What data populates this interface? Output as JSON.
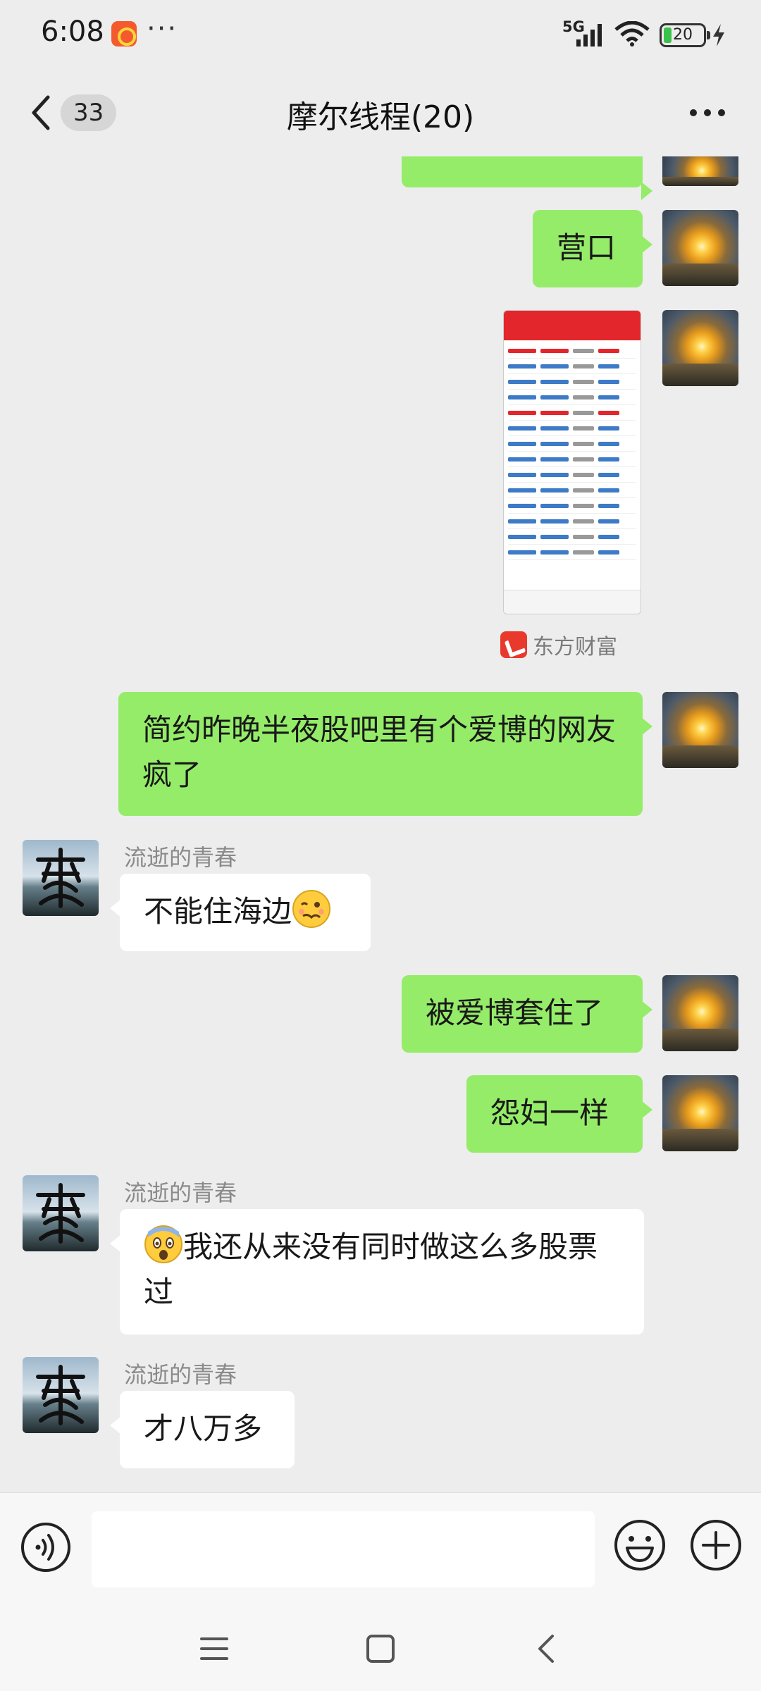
{
  "status_bar": {
    "time": "6:08",
    "more": "···",
    "network": "5G",
    "battery_level": "20",
    "icons": [
      "app-notification-icon",
      "signal-icon",
      "wifi-icon",
      "battery-icon",
      "charging-icon"
    ]
  },
  "header": {
    "unread_count": "33",
    "title": "摩尔线程(20)",
    "icons": [
      "back-icon",
      "more-icon"
    ]
  },
  "messages": [
    {
      "side": "me",
      "type": "text",
      "text": "营口"
    },
    {
      "side": "me",
      "type": "image",
      "source_app": "东方财富"
    },
    {
      "side": "me",
      "type": "text",
      "text": "简约昨晚半夜股吧里有个爱博的网友疯了"
    },
    {
      "side": "other",
      "sender": "流逝的青春",
      "type": "text",
      "text": "不能住海边",
      "emoji": "woozy-face-emoji"
    },
    {
      "side": "me",
      "type": "text",
      "text": "被爱博套住了"
    },
    {
      "side": "me",
      "type": "text",
      "text": "怨妇一样"
    },
    {
      "side": "other",
      "sender": "流逝的青春",
      "type": "text",
      "emoji": "fearful-face-emoji",
      "text": "我还从来没有同时做这么多股票过"
    },
    {
      "side": "other",
      "sender": "流逝的青春",
      "type": "text",
      "text": "才八万多"
    }
  ],
  "input_bar": {
    "placeholder": "",
    "icons": [
      "voice-icon",
      "emoji-icon",
      "plus-icon"
    ]
  },
  "nav_bar": {
    "icons": [
      "menu-icon",
      "home-icon",
      "back-nav-icon"
    ]
  },
  "colors": {
    "my_bubble": "#95ec69",
    "other_bubble": "#ffffff",
    "background": "#ededed"
  }
}
